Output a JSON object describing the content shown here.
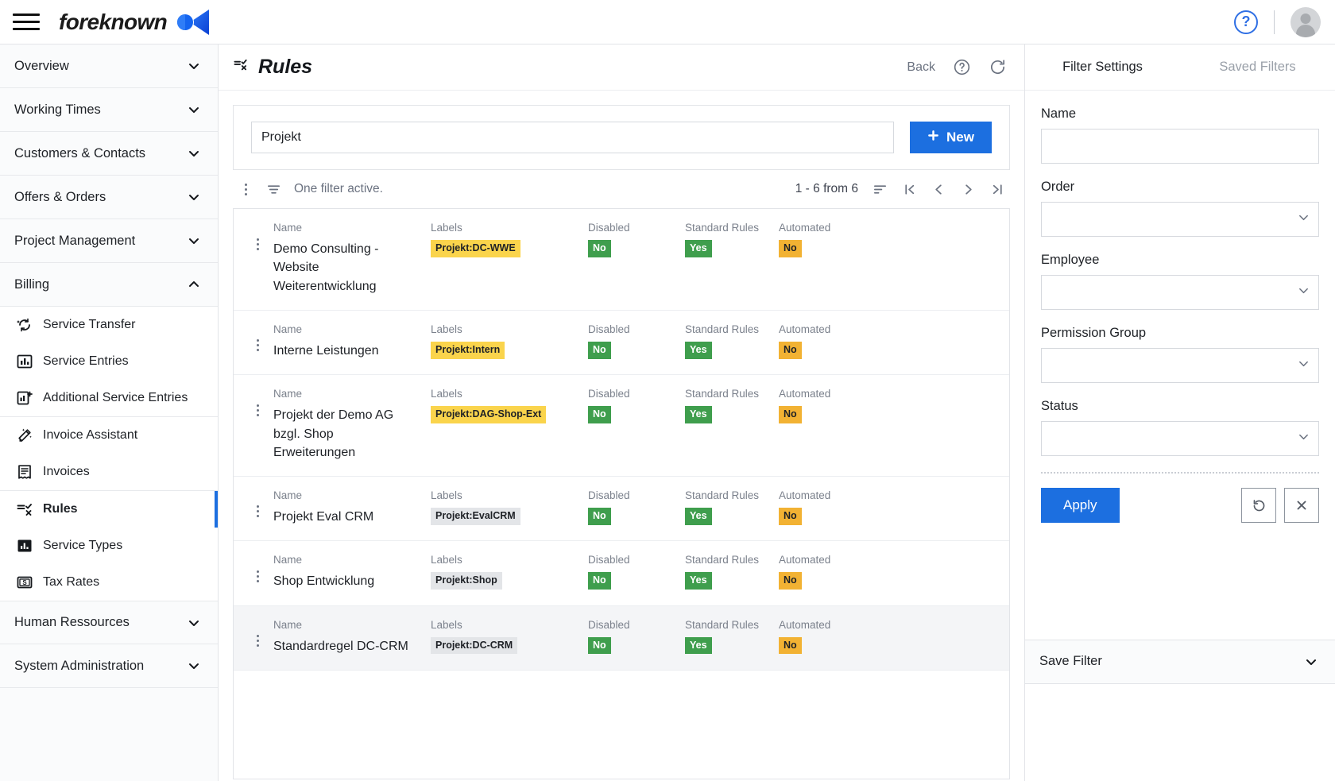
{
  "topbar": {
    "brand_text": "foreknown",
    "menu_icon": "hamburger-icon",
    "help_icon": "help-circle-icon",
    "help_label": "?",
    "avatar_icon": "user-avatar-icon"
  },
  "sidebar": {
    "groups": [
      {
        "label": "Overview",
        "expanded": false
      },
      {
        "label": "Working Times",
        "expanded": false
      },
      {
        "label": "Customers & Contacts",
        "expanded": false
      },
      {
        "label": "Offers & Orders",
        "expanded": false
      },
      {
        "label": "Project Management",
        "expanded": false
      },
      {
        "label": "Billing",
        "expanded": true
      }
    ],
    "billing_items": [
      {
        "label": "Service Transfer",
        "icon": "service-transfer-icon",
        "active": false
      },
      {
        "label": "Service Entries",
        "icon": "bar-chart-icon",
        "active": false
      },
      {
        "label": "Additional Service Entries",
        "icon": "bar-chart-plus-icon",
        "active": false
      },
      {
        "label": "Invoice Assistant",
        "icon": "magic-wand-icon",
        "active": false
      },
      {
        "label": "Invoices",
        "icon": "receipt-icon",
        "active": false
      },
      {
        "label": "Rules",
        "icon": "rules-icon",
        "active": true
      },
      {
        "label": "Service Types",
        "icon": "bar-chart-filled-icon",
        "active": false
      },
      {
        "label": "Tax Rates",
        "icon": "money-icon",
        "active": false
      }
    ],
    "groups_bottom": [
      {
        "label": "Human Ressources",
        "expanded": false
      },
      {
        "label": "System Administration",
        "expanded": false
      }
    ]
  },
  "page": {
    "title": "Rules",
    "title_icon": "rules-icon",
    "back_label": "Back",
    "help_icon": "help-circle-icon",
    "refresh_icon": "refresh-icon"
  },
  "search": {
    "value": "Projekt",
    "placeholder": "",
    "new_label": "New",
    "new_icon": "plus-icon"
  },
  "toolbar": {
    "menu_icon": "kebab-menu-icon",
    "filter_icon": "filter-icon",
    "filter_status": "One filter active.",
    "range_label": "1 - 6 from 6",
    "sort_icon": "sort-icon",
    "first_page_icon": "first-page-icon",
    "prev_page_icon": "prev-page-icon",
    "next_page_icon": "next-page-icon",
    "last_page_icon": "last-page-icon"
  },
  "table": {
    "columns": [
      "Name",
      "Labels",
      "Disabled",
      "Standard Rules",
      "Automated"
    ],
    "rows": [
      {
        "name": "Demo Consulting - Website Weiterentwicklung",
        "label": "Projekt:DC-WWE",
        "label_style": "yellow",
        "disabled": "No",
        "disabled_style": "green",
        "standard_rules": "Yes",
        "standard_rules_style": "green",
        "automated": "No",
        "automated_style": "amber",
        "highlight": false
      },
      {
        "name": "Interne Leistungen",
        "label": "Projekt:Intern",
        "label_style": "yellow",
        "disabled": "No",
        "disabled_style": "green",
        "standard_rules": "Yes",
        "standard_rules_style": "green",
        "automated": "No",
        "automated_style": "amber",
        "highlight": false
      },
      {
        "name": "Projekt der Demo AG bzgl. Shop Erweiterungen",
        "label": "Projekt:DAG-Shop-Ext",
        "label_style": "yellow",
        "disabled": "No",
        "disabled_style": "green",
        "standard_rules": "Yes",
        "standard_rules_style": "green",
        "automated": "No",
        "automated_style": "amber",
        "highlight": false
      },
      {
        "name": "Projekt Eval CRM",
        "label": "Projekt:EvalCRM",
        "label_style": "gray",
        "disabled": "No",
        "disabled_style": "green",
        "standard_rules": "Yes",
        "standard_rules_style": "green",
        "automated": "No",
        "automated_style": "amber",
        "highlight": false
      },
      {
        "name": "Shop Entwicklung",
        "label": "Projekt:Shop",
        "label_style": "gray",
        "disabled": "No",
        "disabled_style": "green",
        "standard_rules": "Yes",
        "standard_rules_style": "green",
        "automated": "No",
        "automated_style": "amber",
        "highlight": false
      },
      {
        "name": "Standardregel DC-CRM",
        "label": "Projekt:DC-CRM",
        "label_style": "gray",
        "disabled": "No",
        "disabled_style": "green",
        "standard_rules": "Yes",
        "standard_rules_style": "green",
        "automated": "No",
        "automated_style": "amber",
        "highlight": true
      }
    ]
  },
  "filters": {
    "tab_settings": "Filter Settings",
    "tab_saved": "Saved Filters",
    "fields": [
      {
        "label": "Name",
        "type": "input",
        "value": ""
      },
      {
        "label": "Order",
        "type": "select",
        "value": ""
      },
      {
        "label": "Employee",
        "type": "select",
        "value": ""
      },
      {
        "label": "Permission Group",
        "type": "select",
        "value": ""
      },
      {
        "label": "Status",
        "type": "select",
        "value": ""
      }
    ],
    "apply_label": "Apply",
    "reset_icon": "reset-icon",
    "clear_icon": "close-icon",
    "save_filter_label": "Save Filter",
    "save_filter_icon": "chevron-down-icon"
  },
  "colors": {
    "accent": "#1c6fe0",
    "green": "#3f9e4d",
    "yellow": "#fad44c",
    "amber": "#f2b233",
    "gray_chip": "#e3e5e8"
  }
}
